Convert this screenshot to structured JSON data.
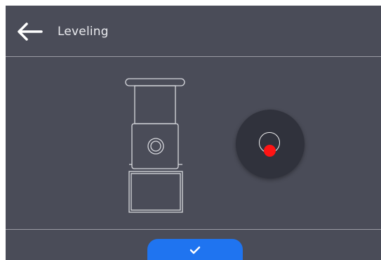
{
  "header": {
    "title": "Leveling",
    "back_icon": "arrow-left-icon"
  },
  "level_indicator": {
    "bubble_color": "#ff1414",
    "status": "not-level"
  },
  "footer": {
    "confirm_icon": "checkmark-icon",
    "confirm_color": "#1f74f0"
  },
  "colors": {
    "background": "#4a4c58",
    "text": "#e9eaee",
    "indicator_bg": "#30323c"
  }
}
